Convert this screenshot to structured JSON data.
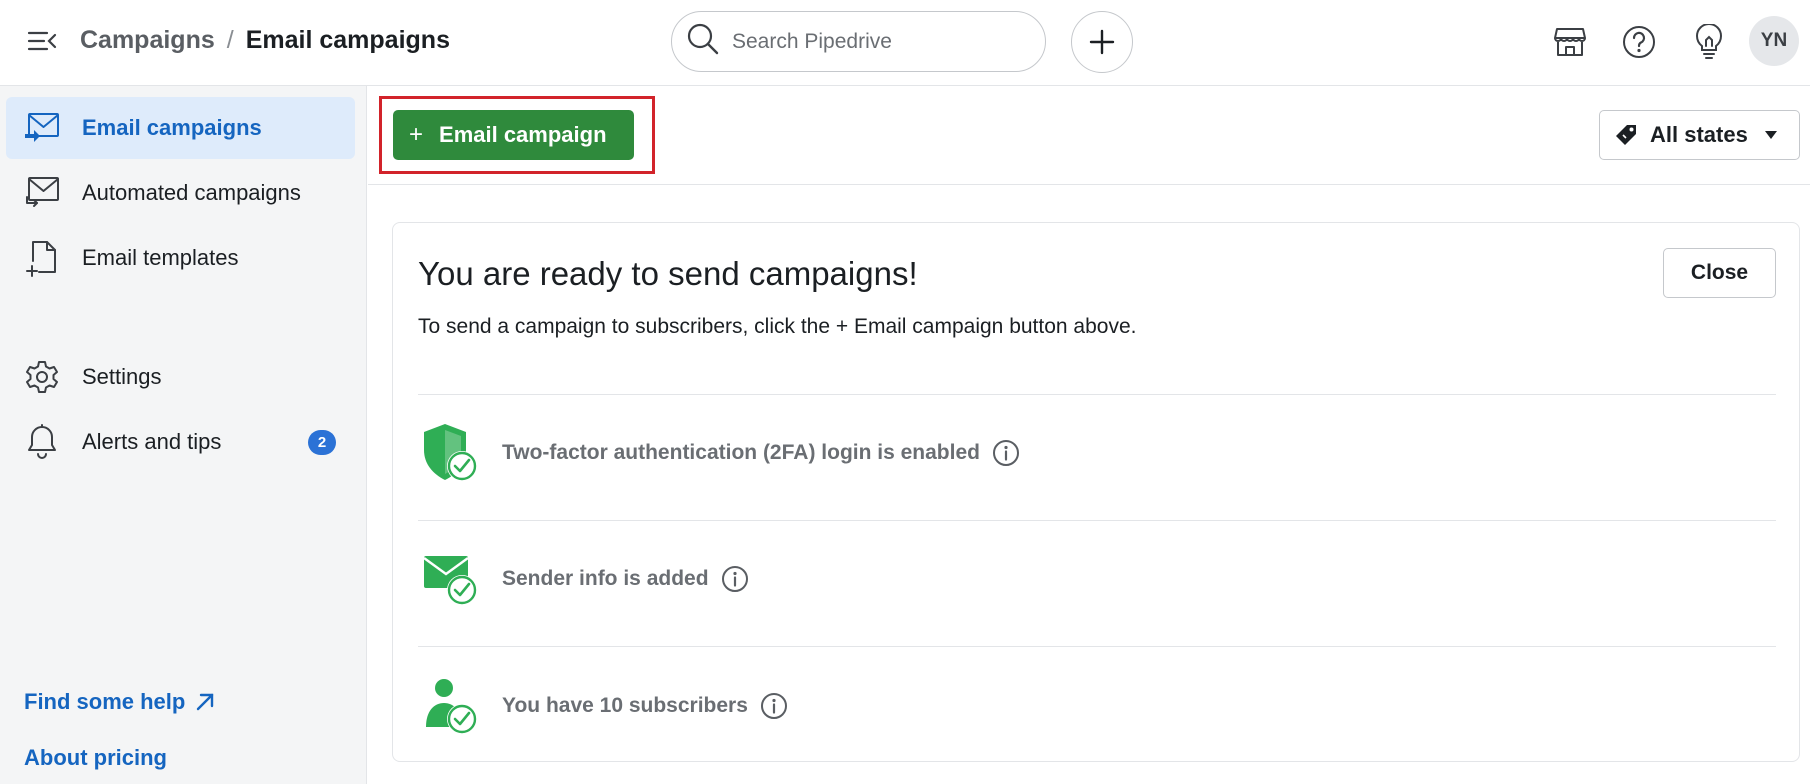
{
  "header": {
    "breadcrumb_parent": "Campaigns",
    "breadcrumb_separator": "/",
    "breadcrumb_current": "Email campaigns",
    "search_placeholder": "Search Pipedrive",
    "avatar_initials": "YN"
  },
  "sidebar": {
    "items": [
      {
        "label": "Email campaigns",
        "icon": "email-campaign-icon",
        "active": true
      },
      {
        "label": "Automated campaigns",
        "icon": "automated-campaign-icon"
      },
      {
        "label": "Email templates",
        "icon": "document-add-icon"
      },
      {
        "label": "Settings",
        "icon": "gear-icon"
      },
      {
        "label": "Alerts and tips",
        "icon": "bell-icon",
        "badge": "2"
      }
    ],
    "links": [
      {
        "label": "Find some help"
      },
      {
        "label": "About pricing"
      }
    ]
  },
  "toolbar": {
    "add_button_plus": "+",
    "add_button_label": "Email campaign",
    "filter_label": "All states"
  },
  "card": {
    "title": "You are ready to send campaigns!",
    "description": "To send a campaign to subscribers, click the + Email campaign button above.",
    "close_label": "Close",
    "checks": [
      {
        "label": "Two-factor authentication (2FA) login is enabled",
        "icon": "shield-check-icon"
      },
      {
        "label": "Sender info is added",
        "icon": "envelope-check-icon"
      },
      {
        "label": "You have 10 subscribers",
        "icon": "person-check-icon"
      }
    ]
  },
  "colors": {
    "accent_blue": "#1565c0",
    "success_green": "#2f8a3c",
    "check_green": "#2fae55",
    "highlight_red": "#d2232a"
  }
}
